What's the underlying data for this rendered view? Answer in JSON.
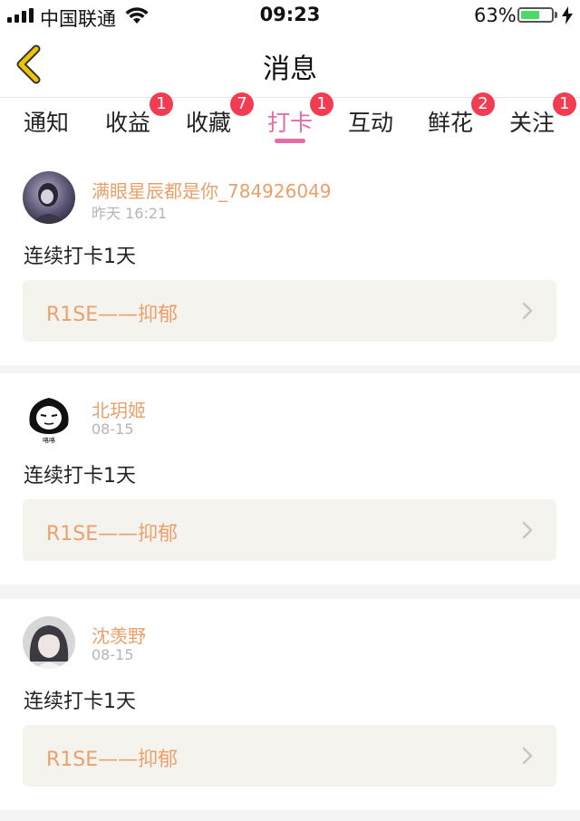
{
  "status_bar": {
    "carrier": "中国联通",
    "time": "09:23",
    "battery_percent": "63%",
    "battery_level": 0.63,
    "battery_color": "#4cd964"
  },
  "nav": {
    "title": "消息",
    "back_icon": "chevron-left-icon",
    "accent_color": "#f0c400"
  },
  "tabs": [
    {
      "label": "通知",
      "badge": ""
    },
    {
      "label": "收益",
      "badge": "1"
    },
    {
      "label": "收藏",
      "badge": "7"
    },
    {
      "label": "打卡",
      "badge": "1",
      "active": true
    },
    {
      "label": "互动",
      "badge": ""
    },
    {
      "label": "鲜花",
      "badge": "2"
    },
    {
      "label": "关注",
      "badge": "1"
    }
  ],
  "colors": {
    "active_tab": "#e86aa6",
    "badge": "#f23c51",
    "username": "#e9a06a",
    "link": "#eba16c"
  },
  "messages": [
    {
      "username": "满眼星辰都是你_784926049",
      "time": "昨天 16:21",
      "text": "连续打卡1天",
      "link": "R1SE——抑郁"
    },
    {
      "username": "北玥姬",
      "time": "08-15",
      "text": "连续打卡1天",
      "link": "R1SE——抑郁"
    },
    {
      "username": "沈羡野",
      "time": "08-15",
      "text": "连续打卡1天",
      "link": "R1SE——抑郁"
    }
  ]
}
